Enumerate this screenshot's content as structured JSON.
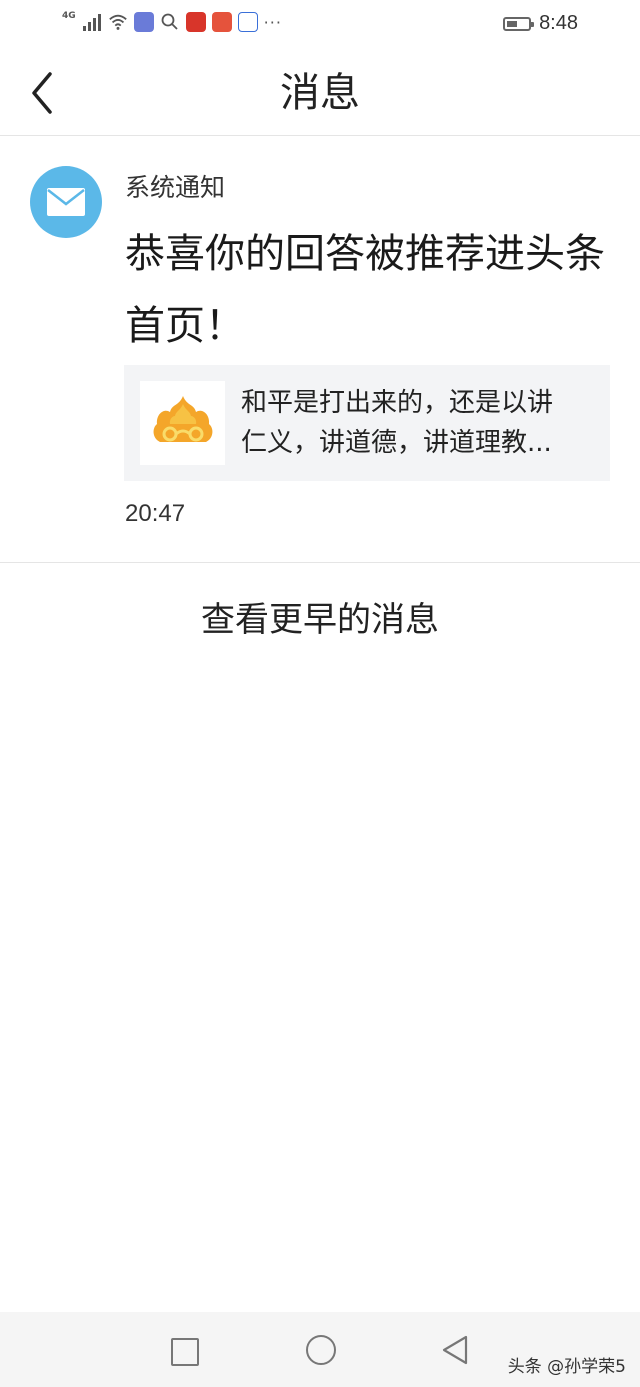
{
  "status_bar": {
    "network": "4G",
    "time": "8:48",
    "battery_level": 0.5,
    "more": "···"
  },
  "header": {
    "back_icon": "chevron-left-icon",
    "title": "消息"
  },
  "message": {
    "avatar_icon": "mail-icon",
    "sender": "系统通知",
    "body": "恭喜你的回答被推荐进头条首页！",
    "card": {
      "thumb_icon": "auspicious-cloud-icon",
      "line1": "和平是打出来的，还是以讲",
      "line2": "仁义，讲道德，讲道理教..."
    },
    "time": "20:47"
  },
  "earlier": {
    "label": "查看更早的消息"
  },
  "nav": {
    "watermark": "头条 @孙学荣5"
  },
  "colors": {
    "avatar": "#5bb8e8",
    "card_bg": "#f3f4f6",
    "divider": "#e5e5e5"
  }
}
